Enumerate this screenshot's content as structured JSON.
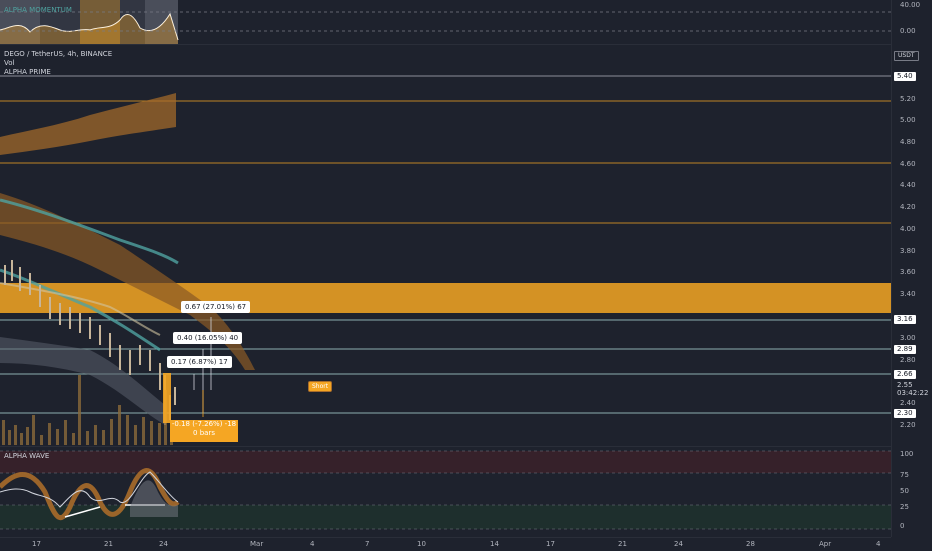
{
  "top_indicator": {
    "name": "ALPHA MOMENTUM",
    "axis_ticks": [
      "40.00",
      "0.00"
    ]
  },
  "legend": {
    "symbol": "DEGO / TetherUS, 4h, BINANCE",
    "vol": "Vol",
    "alpha_prime": "ALPHA PRIME"
  },
  "currency": "USDT",
  "price_ticks": [
    "5.20",
    "5.00",
    "4.80",
    "4.60",
    "4.40",
    "4.20",
    "4.00",
    "3.80",
    "3.60",
    "3.40",
    "3.00",
    "2.80",
    "2.40",
    "2.20"
  ],
  "price_tags": [
    {
      "label": "5.40",
      "bg": "#ffffff",
      "fg": "#131722"
    },
    {
      "label": "3.16",
      "bg": "#ffffff",
      "fg": "#131722"
    },
    {
      "label": "2.89",
      "bg": "#ffffff",
      "fg": "#131722"
    },
    {
      "label": "2.66",
      "bg": "#ffffff",
      "fg": "#131722"
    },
    {
      "label": "2.55",
      "bg": "#1e222d",
      "fg": "#d1d4dc"
    },
    {
      "label": "03:42:22",
      "bg": "#1e222d",
      "fg": "#d1d4dc"
    },
    {
      "label": "2.30",
      "bg": "#ffffff",
      "fg": "#131722"
    }
  ],
  "measure_boxes": {
    "target3": "0.67 (27.01%) 67",
    "target2": "0.40 (16.05%) 40",
    "target1": "0.17 (6.87%) 17",
    "stop_line1": "-0.18 (-7.26%) -18",
    "stop_line2": "0 bars"
  },
  "short_label": "Short",
  "wave": {
    "name": "ALPHA WAVE",
    "axis_ticks": [
      "100",
      "75",
      "50",
      "25",
      "0"
    ]
  },
  "time_labels": [
    "17",
    "21",
    "24",
    "Mar",
    "4",
    "7",
    "10",
    "14",
    "17",
    "21",
    "24",
    "28",
    "Apr",
    "4"
  ],
  "colors": {
    "background": "#1e222d",
    "orange": "#f5a623",
    "teal": "#4fa3a0",
    "level_line": "#b2dfdb"
  }
}
